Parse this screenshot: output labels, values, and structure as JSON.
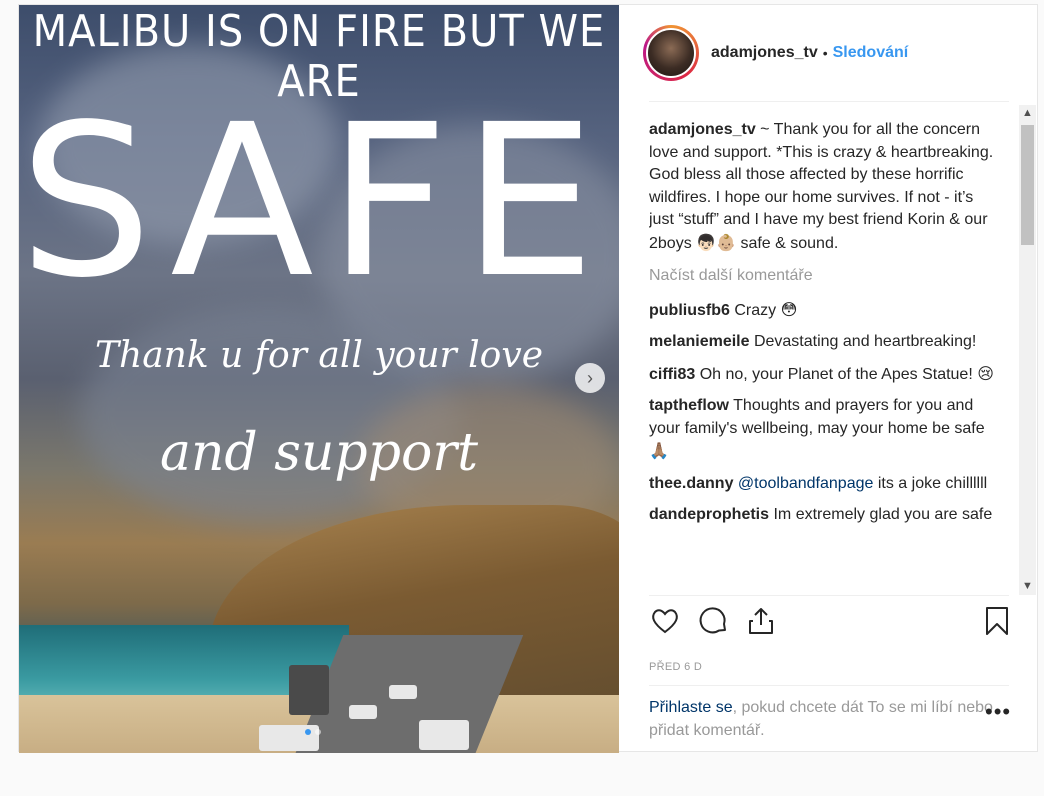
{
  "media": {
    "overlay_line1": "MALIBU IS ON FIRE BUT WE ARE",
    "overlay_line2": "SAFE.",
    "overlay_line3": "Thank u for all your love",
    "overlay_line4": "and support",
    "next_arrow": "›",
    "carousel_count": 2,
    "carousel_active": 1
  },
  "header": {
    "username": "adamjones_tv",
    "separator": "•",
    "follow_label": "Sledování"
  },
  "caption": {
    "username": "adamjones_tv",
    "text": "~ Thank you for all the concern love and support. *This is crazy & heartbreaking. God bless all those affected by these horrific wildfires. I hope our home survives. If not - it’s just “stuff” and I have my best friend Korin & our 2boys",
    "emoji": "👦🏻👶🏼",
    "text_end": "safe & sound."
  },
  "load_more": "Načíst další komentáře",
  "comments": [
    {
      "user": "publiusfb6",
      "text": "Crazy",
      "emoji": "😳"
    },
    {
      "user": "melaniemeile",
      "text": "Devastating and heartbreaking!",
      "emoji": ""
    },
    {
      "user": "ciffi83",
      "text": "Oh no, your Planet of the Apes Statue!",
      "emoji": "😢"
    },
    {
      "user": "taptheflow",
      "text": "Thoughts and prayers for you and your family's wellbeing, may your home be safe",
      "emoji": "🙏🏽"
    },
    {
      "user": "thee.danny",
      "mention": "@toolbandfanpage",
      "text": "its a joke chillllll",
      "emoji": ""
    },
    {
      "user": "dandeprophetis",
      "text": "Im extremely glad you are safe",
      "emoji": ""
    }
  ],
  "scrollbar": {
    "up": "▲",
    "down": "▼"
  },
  "actions": {
    "like_icon": "heart-icon",
    "comment_icon": "comment-icon",
    "share_icon": "share-icon",
    "save_icon": "bookmark-icon"
  },
  "timestamp": "PŘED 6 D",
  "login": {
    "link": "Přihlaste se",
    "text": ", pokud chcete dát To se mi líbí nebo přidat komentář.",
    "more": "•••"
  },
  "colors": {
    "accent": "#3897f0",
    "link": "#003569",
    "muted": "#999999",
    "text": "#262626"
  }
}
